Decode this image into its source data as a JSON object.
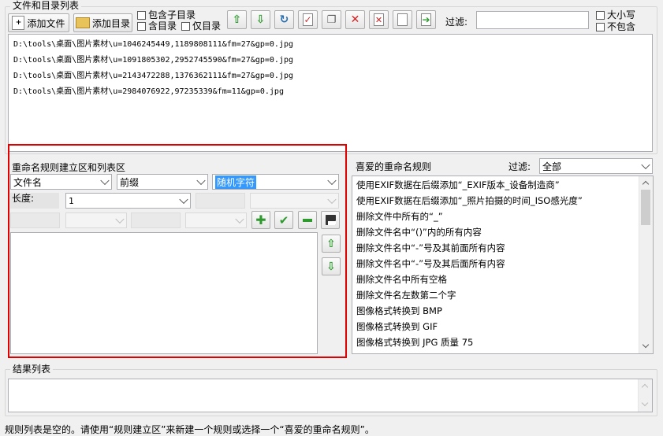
{
  "files_group": {
    "title": "文件和目录列表",
    "add_file_label": "添加文件",
    "add_dir_label": "添加目录",
    "include_subdirs_label": "包含子目录",
    "include_dirs_label": "含目录",
    "dirs_only_label": "仅目录",
    "filter_label": "过滤:",
    "filter_value": "",
    "case_label": "大小写",
    "exclude_label": "不包含",
    "files": [
      "D:\\tools\\桌面\\图片素材\\u=1046245449,1189808111&fm=27&gp=0.jpg",
      "D:\\tools\\桌面\\图片素材\\u=1091805302,2952745590&fm=27&gp=0.jpg",
      "D:\\tools\\桌面\\图片素材\\u=2143472288,1376362111&fm=27&gp=0.jpg",
      "D:\\tools\\桌面\\图片素材\\u=2984076922,97235339&fm=11&gp=0.jpg"
    ]
  },
  "rule_area": {
    "title": "重命名规则建立区和列表区",
    "target_select": "文件名",
    "position_select": "前缀",
    "type_select": "随机字符",
    "length_label": "长度:",
    "length_value": "1"
  },
  "favorites": {
    "title": "喜爱的重命名规则",
    "filter_label": "过滤:",
    "filter_value": "全部",
    "items": [
      "使用EXIF数据在后缀添加“_EXIF版本_设备制造商”",
      "使用EXIF数据在后缀添加“_照片拍摄的时间_ISO感光度”",
      "删除文件中所有的“_”",
      "删除文件名中“()”内的所有内容",
      "删除文件名中“-”号及其前面所有内容",
      "删除文件名中“-”号及其后面所有内容",
      "删除文件名中所有空格",
      "删除文件名左数第二个字",
      "图像格式转换到 BMP",
      "图像格式转换到 GIF",
      "图像格式转换到 JPG 质量 75"
    ]
  },
  "results": {
    "title": "结果列表"
  },
  "status": {
    "text": "规则列表是空的。请使用“规则建立区”来新建一个规则或选择一个“喜爱的重命名规则”。"
  },
  "colors": {
    "accent_red": "#e00000",
    "icon_green": "#2e9a2e",
    "icon_red": "#d62020",
    "select_highlight": "#3399ff"
  }
}
